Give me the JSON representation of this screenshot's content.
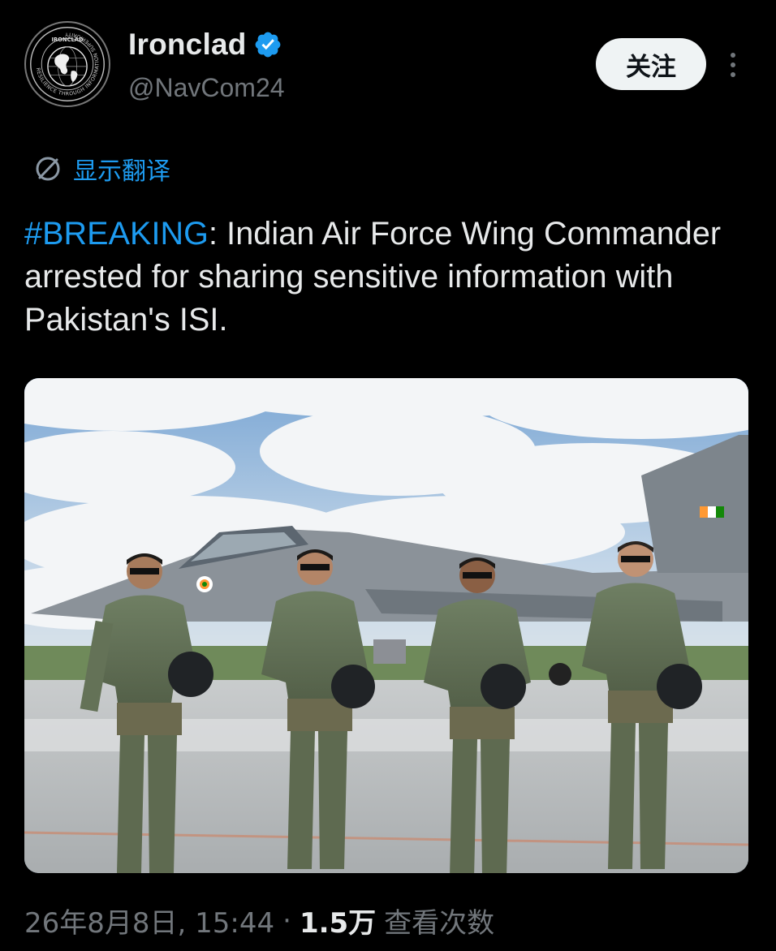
{
  "author": {
    "display_name": "Ironclad",
    "handle": "@NavCom24",
    "avatar_icon": "globe-logo-icon",
    "avatar_logo_text": "IRONCLAD",
    "avatar_logo_ring_text": "RESILIENCE THROUGH INFORMATION SUPERIORITY",
    "verified_icon": "verified-badge-icon",
    "verified_color": "#1d9bf0"
  },
  "actions": {
    "follow_label": "关注",
    "more_icon": "more-vertical-icon"
  },
  "translate": {
    "label": "显示翻译",
    "icon": "translate-globe-icon"
  },
  "tweet": {
    "hashtag": "#BREAKING",
    "text": ": Indian Air Force Wing Commander arrested for sharing sensitive information with Pakistan's ISI."
  },
  "media": {
    "image_alt_icon": "photo-pilots-jet"
  },
  "footer": {
    "timestamp": "26年8月8日, 15:44",
    "separator": "·",
    "views_count": "1.5万",
    "views_label": "查看次数"
  },
  "colors": {
    "background": "#000000",
    "text": "#e7e9ea",
    "muted": "#71767b",
    "accent": "#1d9bf0",
    "button_bg": "#eff3f4"
  }
}
